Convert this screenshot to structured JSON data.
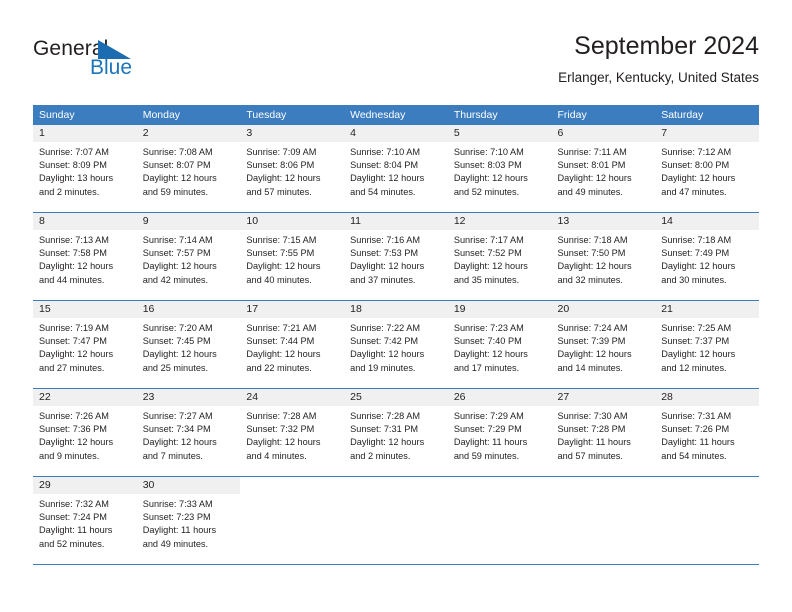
{
  "brand": {
    "name_part1": "General",
    "name_part2": "Blue",
    "accent_color": "#1b75bb",
    "header_color": "#3c7dc0"
  },
  "header": {
    "title": "September 2024",
    "subtitle": "Erlanger, Kentucky, United States"
  },
  "weekdays": [
    "Sunday",
    "Monday",
    "Tuesday",
    "Wednesday",
    "Thursday",
    "Friday",
    "Saturday"
  ],
  "weeks": [
    [
      {
        "day": "1",
        "sunrise": "Sunrise: 7:07 AM",
        "sunset": "Sunset: 8:09 PM",
        "daylight1": "Daylight: 13 hours",
        "daylight2": "and 2 minutes."
      },
      {
        "day": "2",
        "sunrise": "Sunrise: 7:08 AM",
        "sunset": "Sunset: 8:07 PM",
        "daylight1": "Daylight: 12 hours",
        "daylight2": "and 59 minutes."
      },
      {
        "day": "3",
        "sunrise": "Sunrise: 7:09 AM",
        "sunset": "Sunset: 8:06 PM",
        "daylight1": "Daylight: 12 hours",
        "daylight2": "and 57 minutes."
      },
      {
        "day": "4",
        "sunrise": "Sunrise: 7:10 AM",
        "sunset": "Sunset: 8:04 PM",
        "daylight1": "Daylight: 12 hours",
        "daylight2": "and 54 minutes."
      },
      {
        "day": "5",
        "sunrise": "Sunrise: 7:10 AM",
        "sunset": "Sunset: 8:03 PM",
        "daylight1": "Daylight: 12 hours",
        "daylight2": "and 52 minutes."
      },
      {
        "day": "6",
        "sunrise": "Sunrise: 7:11 AM",
        "sunset": "Sunset: 8:01 PM",
        "daylight1": "Daylight: 12 hours",
        "daylight2": "and 49 minutes."
      },
      {
        "day": "7",
        "sunrise": "Sunrise: 7:12 AM",
        "sunset": "Sunset: 8:00 PM",
        "daylight1": "Daylight: 12 hours",
        "daylight2": "and 47 minutes."
      }
    ],
    [
      {
        "day": "8",
        "sunrise": "Sunrise: 7:13 AM",
        "sunset": "Sunset: 7:58 PM",
        "daylight1": "Daylight: 12 hours",
        "daylight2": "and 44 minutes."
      },
      {
        "day": "9",
        "sunrise": "Sunrise: 7:14 AM",
        "sunset": "Sunset: 7:57 PM",
        "daylight1": "Daylight: 12 hours",
        "daylight2": "and 42 minutes."
      },
      {
        "day": "10",
        "sunrise": "Sunrise: 7:15 AM",
        "sunset": "Sunset: 7:55 PM",
        "daylight1": "Daylight: 12 hours",
        "daylight2": "and 40 minutes."
      },
      {
        "day": "11",
        "sunrise": "Sunrise: 7:16 AM",
        "sunset": "Sunset: 7:53 PM",
        "daylight1": "Daylight: 12 hours",
        "daylight2": "and 37 minutes."
      },
      {
        "day": "12",
        "sunrise": "Sunrise: 7:17 AM",
        "sunset": "Sunset: 7:52 PM",
        "daylight1": "Daylight: 12 hours",
        "daylight2": "and 35 minutes."
      },
      {
        "day": "13",
        "sunrise": "Sunrise: 7:18 AM",
        "sunset": "Sunset: 7:50 PM",
        "daylight1": "Daylight: 12 hours",
        "daylight2": "and 32 minutes."
      },
      {
        "day": "14",
        "sunrise": "Sunrise: 7:18 AM",
        "sunset": "Sunset: 7:49 PM",
        "daylight1": "Daylight: 12 hours",
        "daylight2": "and 30 minutes."
      }
    ],
    [
      {
        "day": "15",
        "sunrise": "Sunrise: 7:19 AM",
        "sunset": "Sunset: 7:47 PM",
        "daylight1": "Daylight: 12 hours",
        "daylight2": "and 27 minutes."
      },
      {
        "day": "16",
        "sunrise": "Sunrise: 7:20 AM",
        "sunset": "Sunset: 7:45 PM",
        "daylight1": "Daylight: 12 hours",
        "daylight2": "and 25 minutes."
      },
      {
        "day": "17",
        "sunrise": "Sunrise: 7:21 AM",
        "sunset": "Sunset: 7:44 PM",
        "daylight1": "Daylight: 12 hours",
        "daylight2": "and 22 minutes."
      },
      {
        "day": "18",
        "sunrise": "Sunrise: 7:22 AM",
        "sunset": "Sunset: 7:42 PM",
        "daylight1": "Daylight: 12 hours",
        "daylight2": "and 19 minutes."
      },
      {
        "day": "19",
        "sunrise": "Sunrise: 7:23 AM",
        "sunset": "Sunset: 7:40 PM",
        "daylight1": "Daylight: 12 hours",
        "daylight2": "and 17 minutes."
      },
      {
        "day": "20",
        "sunrise": "Sunrise: 7:24 AM",
        "sunset": "Sunset: 7:39 PM",
        "daylight1": "Daylight: 12 hours",
        "daylight2": "and 14 minutes."
      },
      {
        "day": "21",
        "sunrise": "Sunrise: 7:25 AM",
        "sunset": "Sunset: 7:37 PM",
        "daylight1": "Daylight: 12 hours",
        "daylight2": "and 12 minutes."
      }
    ],
    [
      {
        "day": "22",
        "sunrise": "Sunrise: 7:26 AM",
        "sunset": "Sunset: 7:36 PM",
        "daylight1": "Daylight: 12 hours",
        "daylight2": "and 9 minutes."
      },
      {
        "day": "23",
        "sunrise": "Sunrise: 7:27 AM",
        "sunset": "Sunset: 7:34 PM",
        "daylight1": "Daylight: 12 hours",
        "daylight2": "and 7 minutes."
      },
      {
        "day": "24",
        "sunrise": "Sunrise: 7:28 AM",
        "sunset": "Sunset: 7:32 PM",
        "daylight1": "Daylight: 12 hours",
        "daylight2": "and 4 minutes."
      },
      {
        "day": "25",
        "sunrise": "Sunrise: 7:28 AM",
        "sunset": "Sunset: 7:31 PM",
        "daylight1": "Daylight: 12 hours",
        "daylight2": "and 2 minutes."
      },
      {
        "day": "26",
        "sunrise": "Sunrise: 7:29 AM",
        "sunset": "Sunset: 7:29 PM",
        "daylight1": "Daylight: 11 hours",
        "daylight2": "and 59 minutes."
      },
      {
        "day": "27",
        "sunrise": "Sunrise: 7:30 AM",
        "sunset": "Sunset: 7:28 PM",
        "daylight1": "Daylight: 11 hours",
        "daylight2": "and 57 minutes."
      },
      {
        "day": "28",
        "sunrise": "Sunrise: 7:31 AM",
        "sunset": "Sunset: 7:26 PM",
        "daylight1": "Daylight: 11 hours",
        "daylight2": "and 54 minutes."
      }
    ],
    [
      {
        "day": "29",
        "sunrise": "Sunrise: 7:32 AM",
        "sunset": "Sunset: 7:24 PM",
        "daylight1": "Daylight: 11 hours",
        "daylight2": "and 52 minutes."
      },
      {
        "day": "30",
        "sunrise": "Sunrise: 7:33 AM",
        "sunset": "Sunset: 7:23 PM",
        "daylight1": "Daylight: 11 hours",
        "daylight2": "and 49 minutes."
      },
      null,
      null,
      null,
      null,
      null
    ]
  ]
}
